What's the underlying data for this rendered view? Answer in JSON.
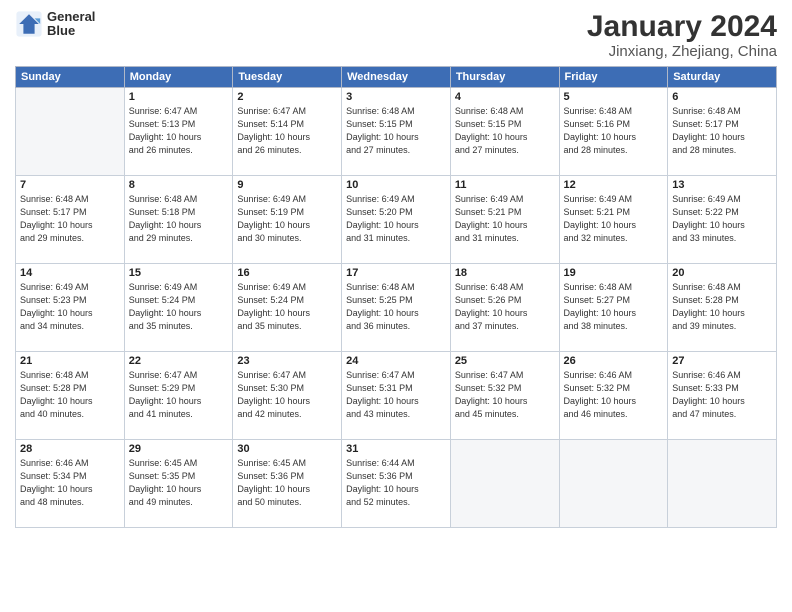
{
  "header": {
    "logo_line1": "General",
    "logo_line2": "Blue",
    "month": "January 2024",
    "location": "Jinxiang, Zhejiang, China"
  },
  "weekdays": [
    "Sunday",
    "Monday",
    "Tuesday",
    "Wednesday",
    "Thursday",
    "Friday",
    "Saturday"
  ],
  "weeks": [
    [
      {
        "day": "",
        "info": ""
      },
      {
        "day": "1",
        "info": "Sunrise: 6:47 AM\nSunset: 5:13 PM\nDaylight: 10 hours\nand 26 minutes."
      },
      {
        "day": "2",
        "info": "Sunrise: 6:47 AM\nSunset: 5:14 PM\nDaylight: 10 hours\nand 26 minutes."
      },
      {
        "day": "3",
        "info": "Sunrise: 6:48 AM\nSunset: 5:15 PM\nDaylight: 10 hours\nand 27 minutes."
      },
      {
        "day": "4",
        "info": "Sunrise: 6:48 AM\nSunset: 5:15 PM\nDaylight: 10 hours\nand 27 minutes."
      },
      {
        "day": "5",
        "info": "Sunrise: 6:48 AM\nSunset: 5:16 PM\nDaylight: 10 hours\nand 28 minutes."
      },
      {
        "day": "6",
        "info": "Sunrise: 6:48 AM\nSunset: 5:17 PM\nDaylight: 10 hours\nand 28 minutes."
      }
    ],
    [
      {
        "day": "7",
        "info": "Sunrise: 6:48 AM\nSunset: 5:17 PM\nDaylight: 10 hours\nand 29 minutes."
      },
      {
        "day": "8",
        "info": "Sunrise: 6:48 AM\nSunset: 5:18 PM\nDaylight: 10 hours\nand 29 minutes."
      },
      {
        "day": "9",
        "info": "Sunrise: 6:49 AM\nSunset: 5:19 PM\nDaylight: 10 hours\nand 30 minutes."
      },
      {
        "day": "10",
        "info": "Sunrise: 6:49 AM\nSunset: 5:20 PM\nDaylight: 10 hours\nand 31 minutes."
      },
      {
        "day": "11",
        "info": "Sunrise: 6:49 AM\nSunset: 5:21 PM\nDaylight: 10 hours\nand 31 minutes."
      },
      {
        "day": "12",
        "info": "Sunrise: 6:49 AM\nSunset: 5:21 PM\nDaylight: 10 hours\nand 32 minutes."
      },
      {
        "day": "13",
        "info": "Sunrise: 6:49 AM\nSunset: 5:22 PM\nDaylight: 10 hours\nand 33 minutes."
      }
    ],
    [
      {
        "day": "14",
        "info": "Sunrise: 6:49 AM\nSunset: 5:23 PM\nDaylight: 10 hours\nand 34 minutes."
      },
      {
        "day": "15",
        "info": "Sunrise: 6:49 AM\nSunset: 5:24 PM\nDaylight: 10 hours\nand 35 minutes."
      },
      {
        "day": "16",
        "info": "Sunrise: 6:49 AM\nSunset: 5:24 PM\nDaylight: 10 hours\nand 35 minutes."
      },
      {
        "day": "17",
        "info": "Sunrise: 6:48 AM\nSunset: 5:25 PM\nDaylight: 10 hours\nand 36 minutes."
      },
      {
        "day": "18",
        "info": "Sunrise: 6:48 AM\nSunset: 5:26 PM\nDaylight: 10 hours\nand 37 minutes."
      },
      {
        "day": "19",
        "info": "Sunrise: 6:48 AM\nSunset: 5:27 PM\nDaylight: 10 hours\nand 38 minutes."
      },
      {
        "day": "20",
        "info": "Sunrise: 6:48 AM\nSunset: 5:28 PM\nDaylight: 10 hours\nand 39 minutes."
      }
    ],
    [
      {
        "day": "21",
        "info": "Sunrise: 6:48 AM\nSunset: 5:28 PM\nDaylight: 10 hours\nand 40 minutes."
      },
      {
        "day": "22",
        "info": "Sunrise: 6:47 AM\nSunset: 5:29 PM\nDaylight: 10 hours\nand 41 minutes."
      },
      {
        "day": "23",
        "info": "Sunrise: 6:47 AM\nSunset: 5:30 PM\nDaylight: 10 hours\nand 42 minutes."
      },
      {
        "day": "24",
        "info": "Sunrise: 6:47 AM\nSunset: 5:31 PM\nDaylight: 10 hours\nand 43 minutes."
      },
      {
        "day": "25",
        "info": "Sunrise: 6:47 AM\nSunset: 5:32 PM\nDaylight: 10 hours\nand 45 minutes."
      },
      {
        "day": "26",
        "info": "Sunrise: 6:46 AM\nSunset: 5:32 PM\nDaylight: 10 hours\nand 46 minutes."
      },
      {
        "day": "27",
        "info": "Sunrise: 6:46 AM\nSunset: 5:33 PM\nDaylight: 10 hours\nand 47 minutes."
      }
    ],
    [
      {
        "day": "28",
        "info": "Sunrise: 6:46 AM\nSunset: 5:34 PM\nDaylight: 10 hours\nand 48 minutes."
      },
      {
        "day": "29",
        "info": "Sunrise: 6:45 AM\nSunset: 5:35 PM\nDaylight: 10 hours\nand 49 minutes."
      },
      {
        "day": "30",
        "info": "Sunrise: 6:45 AM\nSunset: 5:36 PM\nDaylight: 10 hours\nand 50 minutes."
      },
      {
        "day": "31",
        "info": "Sunrise: 6:44 AM\nSunset: 5:36 PM\nDaylight: 10 hours\nand 52 minutes."
      },
      {
        "day": "",
        "info": ""
      },
      {
        "day": "",
        "info": ""
      },
      {
        "day": "",
        "info": ""
      }
    ]
  ]
}
